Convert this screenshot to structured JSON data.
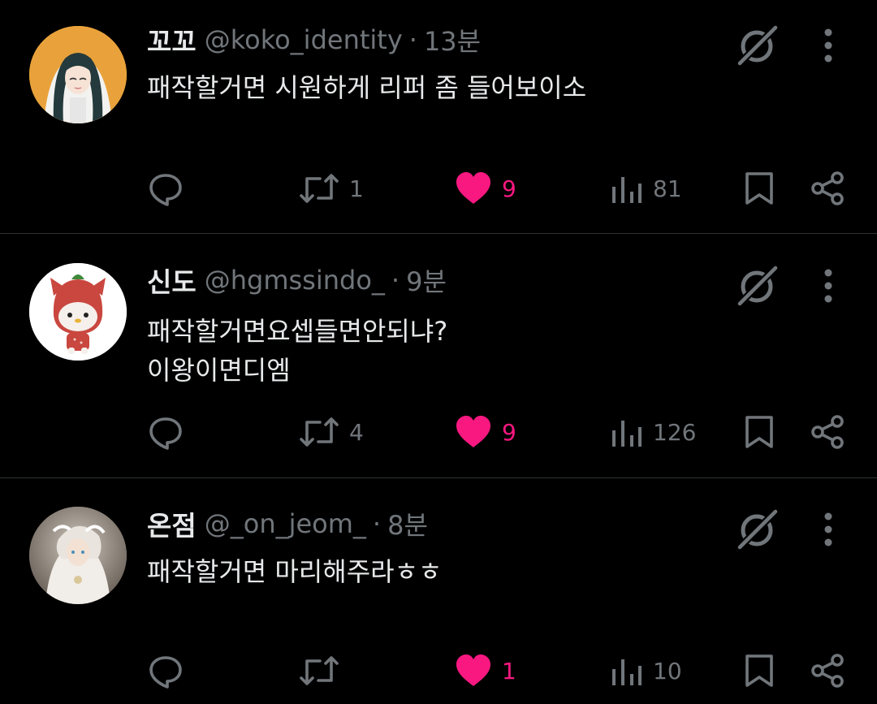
{
  "colors": {
    "background": "#000000",
    "text_primary": "#e7e9ea",
    "text_secondary": "#71767b",
    "like_active": "#f91880",
    "divider": "#2f3336"
  },
  "posts": [
    {
      "display_name": "꼬꼬",
      "handle": "@koko_identity",
      "separator": "·",
      "time": "13분",
      "text": "패작할거면 시원하게 리퍼 좀 들어보이소",
      "replies": "",
      "reposts": "1",
      "likes": "9",
      "liked": true,
      "views": "81",
      "avatar_icon": "anime-girl-avatar"
    },
    {
      "display_name": "신도",
      "handle": "@hgmssindo_",
      "separator": "·",
      "time": "9분",
      "text": "패작할거면요셉들면안되냐?\n이왕이면디엠",
      "replies": "",
      "reposts": "4",
      "likes": "9",
      "liked": true,
      "views": "126",
      "avatar_icon": "strawberry-cat-avatar"
    },
    {
      "display_name": "온점",
      "handle": "@_on_jeom_",
      "separator": "·",
      "time": "8분",
      "text": "패작할거면 마리해주라ㅎㅎ",
      "replies": "",
      "reposts": "",
      "likes": "1",
      "liked": true,
      "views": "10",
      "avatar_icon": "white-dress-character-avatar"
    }
  ]
}
